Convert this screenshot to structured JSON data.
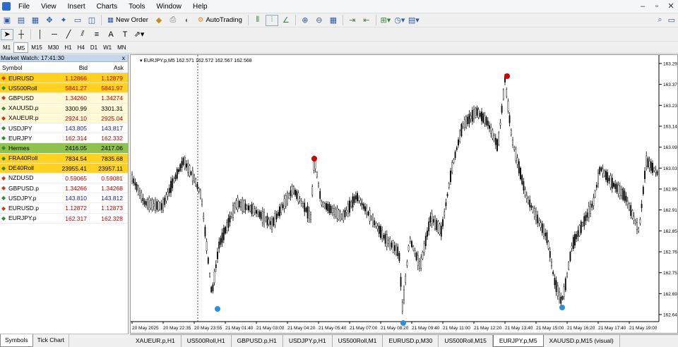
{
  "menu": [
    "File",
    "View",
    "Insert",
    "Charts",
    "Tools",
    "Window",
    "Help"
  ],
  "window_controls": [
    "–",
    "▫",
    "✕"
  ],
  "toolbar": {
    "new_order": "New Order",
    "auto_trading": "AutoTrading"
  },
  "timeframes": [
    "M1",
    "M5",
    "M15",
    "M30",
    "H1",
    "H4",
    "D1",
    "W1",
    "MN"
  ],
  "active_timeframe": "M5",
  "market_watch": {
    "title": "Market Watch: 17:41:30",
    "close": "x",
    "columns": [
      "Symbol",
      "Bid",
      "Ask"
    ],
    "rows": [
      {
        "symbol": "EURUSD",
        "bid": "1.12866",
        "ask": "1.12879",
        "dir": "down",
        "bg": "#ffd21f",
        "color": "#c00000"
      },
      {
        "symbol": "US500Roll",
        "bid": "5841.27",
        "ask": "5841.97",
        "dir": "up",
        "bg": "#ffd21f",
        "color": "#c00000"
      },
      {
        "symbol": "GBPUSD",
        "bid": "1.34260",
        "ask": "1.34274",
        "dir": "down",
        "bg": "#fff9d6",
        "color": "#c00000"
      },
      {
        "symbol": "XAUUSD.p",
        "bid": "3300.99",
        "ask": "3301.31",
        "dir": "up",
        "bg": "#fff9d6",
        "color": "#000000"
      },
      {
        "symbol": "XAUEUR.p",
        "bid": "2924.10",
        "ask": "2925.04",
        "dir": "down",
        "bg": "#fff9d6",
        "color": "#c00000"
      },
      {
        "symbol": "USDJPY",
        "bid": "143.805",
        "ask": "143.817",
        "dir": "up",
        "bg": "#ffffff",
        "color": "#1a1aa0"
      },
      {
        "symbol": "EURJPY",
        "bid": "162.314",
        "ask": "162.332",
        "dir": "up",
        "bg": "#ffffff",
        "color": "#c00000"
      },
      {
        "symbol": "Hermes",
        "bid": "2416.05",
        "ask": "2417.06",
        "dir": "up",
        "bg": "#8fc24a",
        "color": "#000000"
      },
      {
        "symbol": "FRA40Roll",
        "bid": "7834.54",
        "ask": "7835.68",
        "dir": "up",
        "bg": "#ffd21f",
        "color": "#000000"
      },
      {
        "symbol": "DE40Roll",
        "bid": "23955.41",
        "ask": "23957.11",
        "dir": "up",
        "bg": "#ffd21f",
        "color": "#000000"
      },
      {
        "symbol": "NZDUSD",
        "bid": "0.59065",
        "ask": "0.59081",
        "dir": "down",
        "bg": "#ffffff",
        "color": "#c00000"
      },
      {
        "symbol": "GBPUSD.p",
        "bid": "1.34266",
        "ask": "1.34268",
        "dir": "down",
        "bg": "#ffffff",
        "color": "#c00000"
      },
      {
        "symbol": "USDJPY.p",
        "bid": "143.810",
        "ask": "143.812",
        "dir": "up",
        "bg": "#ffffff",
        "color": "#1a1aa0"
      },
      {
        "symbol": "EURUSD.p",
        "bid": "1.12872",
        "ask": "1.12873",
        "dir": "down",
        "bg": "#ffffff",
        "color": "#c00000"
      },
      {
        "symbol": "EURJPY.p",
        "bid": "162.317",
        "ask": "162.328",
        "dir": "up",
        "bg": "#ffffff",
        "color": "#c00000"
      }
    ],
    "tabs": [
      "Symbols",
      "Tick Chart"
    ]
  },
  "chart": {
    "header": "EURJPY.p,M5  162.571 162.572 162.567 162.568",
    "price_ticks": [
      "163.29",
      "163.37",
      "163.23",
      "163.14",
      "163.09",
      "163.03",
      "162.95",
      "162.91",
      "162.85",
      "162.76",
      "162.75",
      "162.69",
      "162.64"
    ],
    "time_ticks": [
      "20 May 2025",
      "20 May 22:35",
      "20 May 23:55",
      "21 May 01:40",
      "21 May 03:00",
      "21 May 04:20",
      "21 May 05:40",
      "21 May 07:00",
      "21 May 08:20",
      "21 May 09:40",
      "21 May 11:00",
      "21 May 12:20",
      "21 May 13:40",
      "21 May 15:00",
      "21 May 16:20",
      "21 May 17:40",
      "21 May 19:00"
    ],
    "markers": [
      {
        "type": "top",
        "color": "#d40000"
      },
      {
        "type": "top",
        "color": "#d40000"
      },
      {
        "type": "bottom",
        "color": "#2a8fe0"
      },
      {
        "type": "bottom",
        "color": "#2a8fe0"
      },
      {
        "type": "bottom",
        "color": "#2a8fe0"
      }
    ]
  },
  "chart_tabs": [
    "XAUEUR.p,H1",
    "US500Roll,H1",
    "GBPUSD.p,H1",
    "USDJPY.p,H1",
    "US500Roll,M1",
    "EURUSD.p,M30",
    "US500Roll,M15",
    "EURJPY.p,M5",
    "XAUUSD.p,M15 (visual)"
  ],
  "active_chart_tab": "EURJPY.p,M5"
}
